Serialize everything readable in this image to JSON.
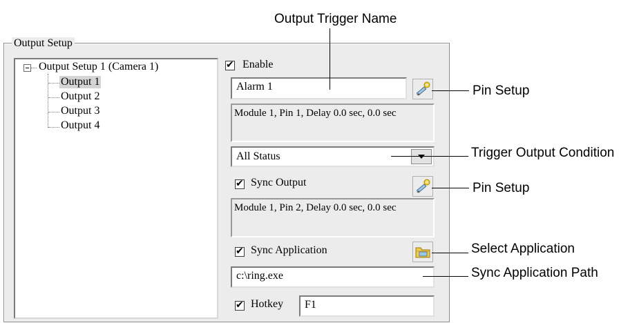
{
  "group": {
    "title": "Output Setup"
  },
  "tree": {
    "root": "Output Setup 1 (Camera 1)",
    "items": [
      "Output 1",
      "Output 2",
      "Output 3",
      "Output 4"
    ],
    "selected_index": 0
  },
  "form": {
    "enable_label": "Enable",
    "enable_checked": true,
    "trigger_name_value": "Alarm 1",
    "pin_info_1": "Module 1, Pin 1, Delay 0.0 sec, 0.0 sec",
    "condition_value": "All Status",
    "sync_output_label": "Sync Output",
    "sync_output_checked": true,
    "pin_info_2": "Module 1, Pin 2, Delay 0.0 sec, 0.0 sec",
    "sync_app_label": "Sync Application",
    "sync_app_checked": true,
    "sync_app_path": "c:\\ring.exe",
    "hotkey_label": "Hotkey",
    "hotkey_checked": true,
    "hotkey_value": "F1"
  },
  "callouts": {
    "output_trigger_name": "Output Trigger Name",
    "pin_setup_1": "Pin Setup",
    "trigger_output_condition": "Trigger Output Condition",
    "pin_setup_2": "Pin Setup",
    "select_application": "Select Application",
    "sync_application_path": "Sync Application Path"
  },
  "icons": {
    "pin_setup": "pencil-wrench-icon",
    "select_app": "folder-icon",
    "dropdown": "triangle-down-icon"
  }
}
